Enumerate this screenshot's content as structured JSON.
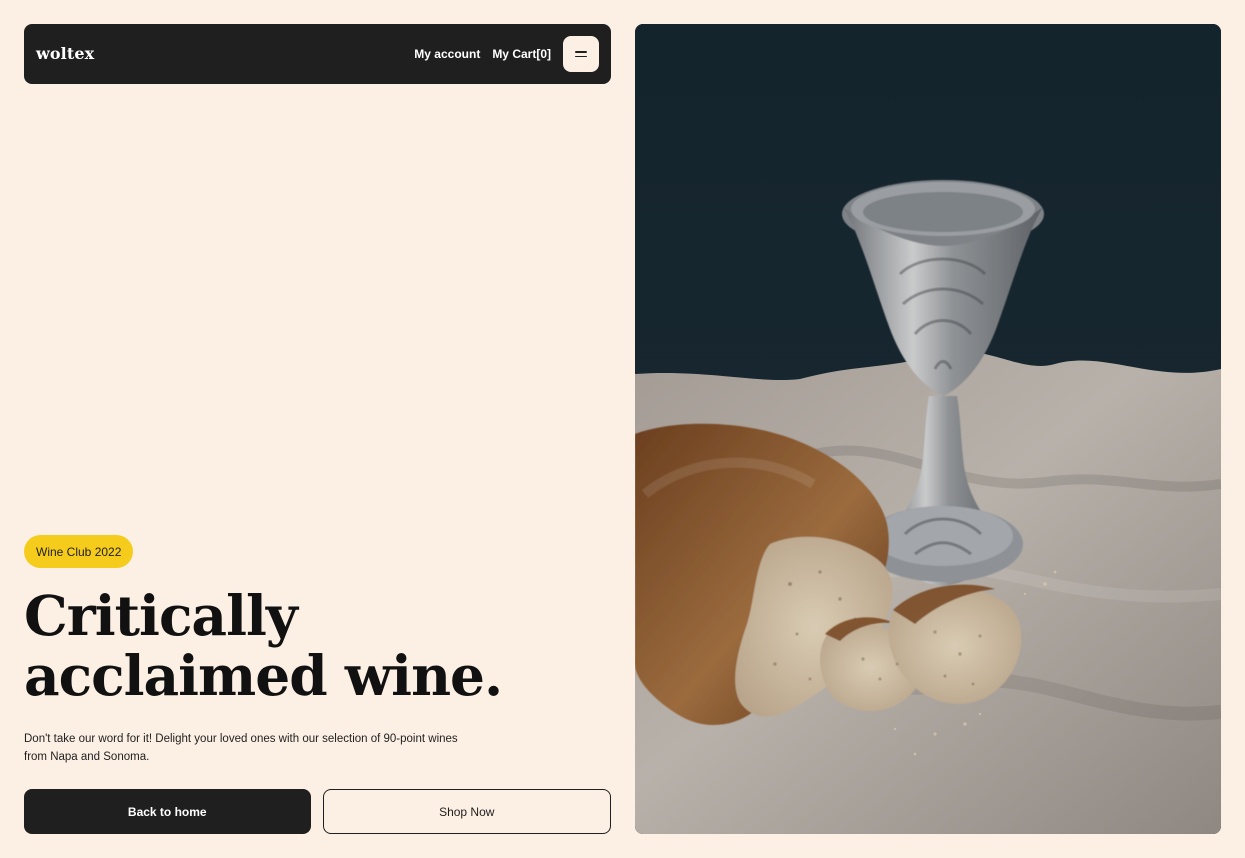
{
  "header": {
    "brand": "woltex",
    "my_account": "My account",
    "my_cart": "My Cart[0]",
    "menu_icon": "menu-icon"
  },
  "hero": {
    "badge": "Wine Club 2022",
    "title_line1": "Critically",
    "title_line2": "acclaimed wine.",
    "description_line1": "Don't take our word for it! Delight your loved ones with our selection of 90-point wines",
    "description_line2": "from Napa and Sonoma.",
    "buttons": {
      "back_home": "Back to home",
      "shop_now": "Shop Now"
    }
  },
  "colors": {
    "page_bg": "#fcefe4",
    "nav_bg": "#1f1f1f",
    "badge_bg": "#f6cc1c",
    "text_dark": "#111111",
    "image_bg": "#17252c"
  },
  "media": {
    "image": "goblet-and-bread-photo"
  }
}
